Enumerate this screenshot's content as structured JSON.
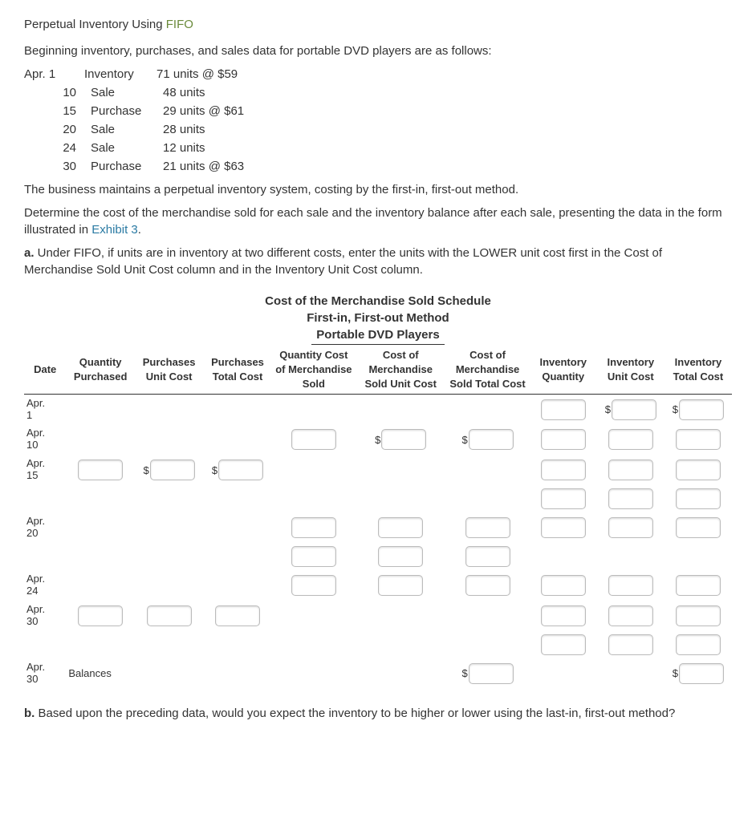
{
  "title_prefix": "Perpetual Inventory Using ",
  "title_method": "FIFO",
  "intro": "Beginning inventory, purchases, and sales data for portable DVD players are as follows:",
  "inv": [
    {
      "c1": "Apr. 1",
      "c2": "Inventory",
      "c3": "71 units @ $59"
    },
    {
      "c1": "10",
      "c2": "Sale",
      "c3": "48 units"
    },
    {
      "c1": "15",
      "c2": "Purchase",
      "c3": "29 units @ $61"
    },
    {
      "c1": "20",
      "c2": "Sale",
      "c3": "28 units"
    },
    {
      "c1": "24",
      "c2": "Sale",
      "c3": "12 units"
    },
    {
      "c1": "30",
      "c2": "Purchase",
      "c3": "21 units @ $63"
    }
  ],
  "para2": "The business maintains a perpetual inventory system, costing by the first-in, first-out method.",
  "para3a": "Determine the cost of the merchandise sold for each sale and the inventory balance after each sale, presenting the data in the form illustrated in ",
  "para3link": "Exhibit 3",
  "para3b": ".",
  "a_label": "a.",
  "a_text": "  Under FIFO, if units are in inventory at two different costs, enter the units with the LOWER unit cost first in the Cost of Merchandise Sold Unit Cost column and in the Inventory Unit Cost column.",
  "sched": {
    "l1": "Cost of the Merchandise Sold Schedule",
    "l2": "First-in, First-out Method",
    "l3": "Portable DVD Players"
  },
  "headers": [
    "Date",
    "Quantity Purchased",
    "Purchases Unit Cost",
    "Purchases Total Cost",
    "Quantity Cost of Merchandise Sold",
    "Cost of Merchandise Sold Unit Cost",
    "Cost of Merchandise Sold Total Cost",
    "Inventory Quantity",
    "Inventory Unit Cost",
    "Inventory Total Cost"
  ],
  "dates": {
    "apr1": "Apr. 1",
    "apr10": "Apr. 10",
    "apr15": "Apr. 15",
    "apr20": "Apr. 20",
    "apr24": "Apr. 24",
    "apr30": "Apr. 30",
    "balances": "Balances"
  },
  "b_label": "b.",
  "b_text": "  Based upon the preceding data, would you expect the inventory to be higher or lower using the last-in, first-out method?"
}
